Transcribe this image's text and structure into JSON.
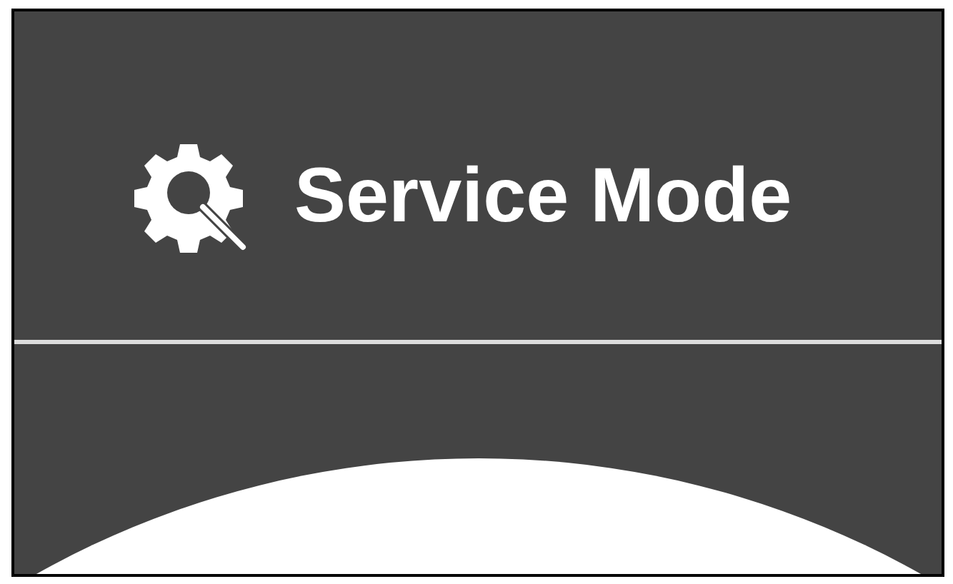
{
  "header": {
    "title": "Service Mode"
  }
}
